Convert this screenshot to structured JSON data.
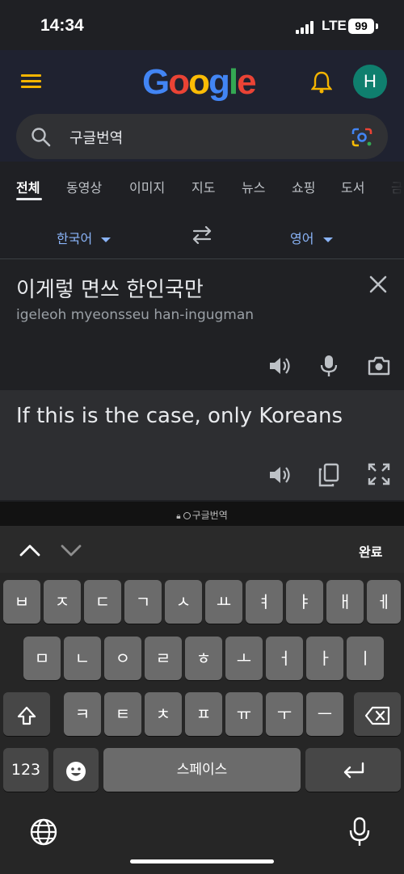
{
  "status": {
    "time": "14:34",
    "network": "LTE",
    "battery": "99"
  },
  "header": {
    "logo": [
      "G",
      "o",
      "o",
      "g",
      "l",
      "e"
    ],
    "avatar_letter": "H"
  },
  "search": {
    "query": "구글번역"
  },
  "tabs": [
    "전체",
    "동영상",
    "이미지",
    "지도",
    "뉴스",
    "쇼핑",
    "도서",
    "금"
  ],
  "translate": {
    "source_lang": "한국어",
    "target_lang": "영어",
    "source_text": "이게렇 면쓰 한인국만",
    "romanization": "igeleoh myeonsseu han-ingugman",
    "result_text": "If this is the case, only Koreans"
  },
  "browser": {
    "url_label": "구글번역"
  },
  "keyboard": {
    "done_label": "완료",
    "row1": [
      "ㅂ",
      "ㅈ",
      "ㄷ",
      "ㄱ",
      "ㅅ",
      "ㅛ",
      "ㅕ",
      "ㅑ",
      "ㅐ",
      "ㅔ"
    ],
    "row2": [
      "ㅁ",
      "ㄴ",
      "ㅇ",
      "ㄹ",
      "ㅎ",
      "ㅗ",
      "ㅓ",
      "ㅏ",
      "ㅣ"
    ],
    "row3": [
      "ㅋ",
      "ㅌ",
      "ㅊ",
      "ㅍ",
      "ㅠ",
      "ㅜ",
      "ㅡ"
    ],
    "numbers_label": "123",
    "space_label": "스페이스"
  },
  "colors": {
    "accent": "#8ab4f8",
    "logo_blue": "#4285f4",
    "logo_red": "#ea4335",
    "logo_yellow": "#fbbc05",
    "logo_green": "#34a853"
  }
}
